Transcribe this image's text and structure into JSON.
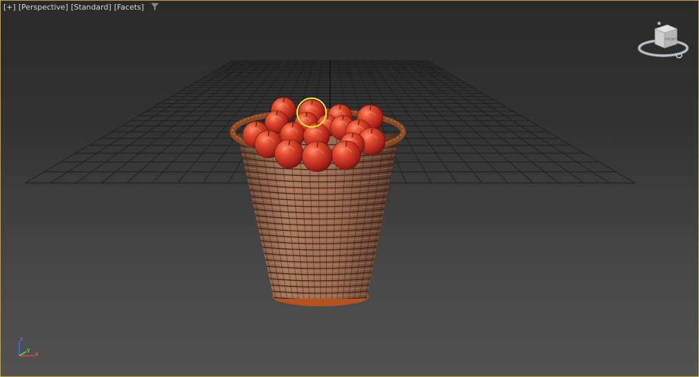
{
  "viewport": {
    "labels": [
      "[+]",
      "[Perspective]",
      "[Standard]",
      "[Facets]"
    ],
    "filter_icon": "filter-icon"
  },
  "viewcube": {
    "face_label": "FRONT"
  },
  "axis": {
    "x": "x",
    "y": "y",
    "z": "z"
  },
  "colors": {
    "background_top": "#2a2a2a",
    "background_bottom": "#525252",
    "grid": "#1c1c1c",
    "viewport_border": "#c9a64a",
    "selection": "#ffee33",
    "apple": "#d33a22",
    "basket": "#8a5a40"
  }
}
